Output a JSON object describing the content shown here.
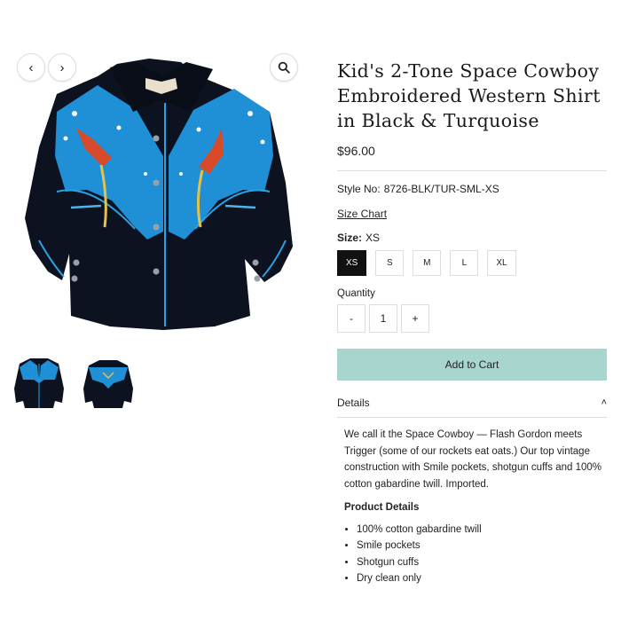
{
  "gallery": {
    "prev_icon": "chevron-left-icon",
    "next_icon": "chevron-right-icon",
    "zoom_icon": "magnifier-icon",
    "prev_glyph": "‹",
    "next_glyph": "›",
    "zoom_glyph": "🔍",
    "colors": {
      "shirt": "#0d1220",
      "yoke": "#1f8fd6",
      "piping": "#2aa3e6"
    },
    "thumbnail_count": 2
  },
  "product": {
    "title": "Kid's 2-Tone Space Cowboy Embroidered Western Shirt in Black & Turquoise",
    "price": "$96.00",
    "style_label": "Style No:",
    "style_value": "8726-BLK/TUR-SML-XS",
    "size_chart": "Size Chart",
    "size_label": "Size:",
    "size_value": "XS",
    "sizes": [
      "XS",
      "S",
      "M",
      "L",
      "XL"
    ],
    "quantity_label": "Quantity",
    "qty_minus": "-",
    "qty_value": "1",
    "qty_plus": "+",
    "add_to_cart": "Add to Cart",
    "accent_color": "#a9d5cf"
  },
  "details": {
    "heading": "Details",
    "chevron_icon": "chevron-up-icon",
    "chevron_glyph": "˄",
    "description": "We call it the Space Cowboy — Flash Gordon meets Trigger (some of our rockets eat oats.) Our top vintage construction with Smile pockets, shotgun cuffs and 100% cotton gabardine twill. Imported.",
    "product_details_title": "Product Details",
    "items": [
      "100% cotton gabardine twill",
      "Smile pockets",
      "Shotgun cuffs",
      "Dry clean only"
    ]
  }
}
